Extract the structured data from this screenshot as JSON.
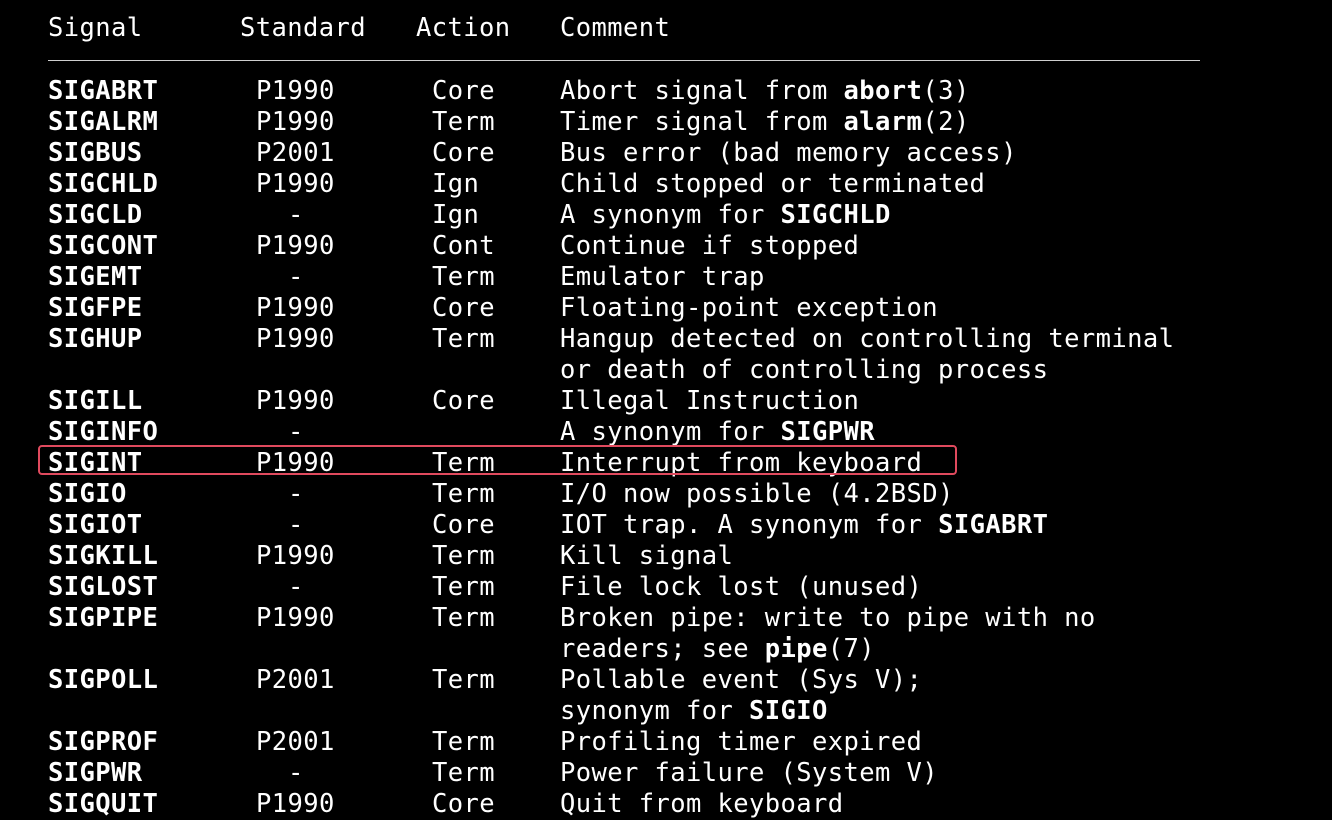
{
  "header": {
    "signal": "Signal",
    "standard": "Standard",
    "action": "Action",
    "comment": "Comment"
  },
  "highlight_color": "#e04a5e",
  "rows": [
    {
      "signal": "SIGABRT",
      "standard": "P1990",
      "action": "Core",
      "comment": [
        [
          {
            "t": "Abort signal from ",
            "b": false
          },
          {
            "t": "abort",
            "b": true
          },
          {
            "t": "(3)",
            "b": false
          }
        ]
      ]
    },
    {
      "signal": "SIGALRM",
      "standard": "P1990",
      "action": "Term",
      "comment": [
        [
          {
            "t": "Timer signal from ",
            "b": false
          },
          {
            "t": "alarm",
            "b": true
          },
          {
            "t": "(2)",
            "b": false
          }
        ]
      ]
    },
    {
      "signal": "SIGBUS",
      "standard": "P2001",
      "action": "Core",
      "comment": [
        [
          {
            "t": "Bus error (bad memory access)",
            "b": false
          }
        ]
      ]
    },
    {
      "signal": "SIGCHLD",
      "standard": "P1990",
      "action": "Ign",
      "comment": [
        [
          {
            "t": "Child stopped or terminated",
            "b": false
          }
        ]
      ]
    },
    {
      "signal": "SIGCLD",
      "standard": "-",
      "action": "Ign",
      "comment": [
        [
          {
            "t": "A synonym for ",
            "b": false
          },
          {
            "t": "SIGCHLD",
            "b": true
          }
        ]
      ]
    },
    {
      "signal": "SIGCONT",
      "standard": "P1990",
      "action": "Cont",
      "comment": [
        [
          {
            "t": "Continue if stopped",
            "b": false
          }
        ]
      ]
    },
    {
      "signal": "SIGEMT",
      "standard": "-",
      "action": "Term",
      "comment": [
        [
          {
            "t": "Emulator trap",
            "b": false
          }
        ]
      ]
    },
    {
      "signal": "SIGFPE",
      "standard": "P1990",
      "action": "Core",
      "comment": [
        [
          {
            "t": "Floating-point exception",
            "b": false
          }
        ]
      ]
    },
    {
      "signal": "SIGHUP",
      "standard": "P1990",
      "action": "Term",
      "comment": [
        [
          {
            "t": "Hangup detected on controlling terminal",
            "b": false
          }
        ],
        [
          {
            "t": "or death of controlling process",
            "b": false
          }
        ]
      ]
    },
    {
      "signal": "SIGILL",
      "standard": "P1990",
      "action": "Core",
      "comment": [
        [
          {
            "t": "Illegal Instruction",
            "b": false
          }
        ]
      ]
    },
    {
      "signal": "SIGINFO",
      "standard": "-",
      "action": "",
      "comment": [
        [
          {
            "t": "A synonym for ",
            "b": false
          },
          {
            "t": "SIGPWR",
            "b": true
          }
        ]
      ]
    },
    {
      "signal": "SIGINT",
      "standard": "P1990",
      "action": "Term",
      "comment": [
        [
          {
            "t": "Interrupt from keyboard",
            "b": false
          }
        ]
      ],
      "highlighted": true
    },
    {
      "signal": "SIGIO",
      "standard": "-",
      "action": "Term",
      "comment": [
        [
          {
            "t": "I/O now possible (4.2BSD)",
            "b": false
          }
        ]
      ]
    },
    {
      "signal": "SIGIOT",
      "standard": "-",
      "action": "Core",
      "comment": [
        [
          {
            "t": "IOT trap. A synonym for ",
            "b": false
          },
          {
            "t": "SIGABRT",
            "b": true
          }
        ]
      ]
    },
    {
      "signal": "SIGKILL",
      "standard": "P1990",
      "action": "Term",
      "comment": [
        [
          {
            "t": "Kill signal",
            "b": false
          }
        ]
      ]
    },
    {
      "signal": "SIGLOST",
      "standard": "-",
      "action": "Term",
      "comment": [
        [
          {
            "t": "File lock lost (unused)",
            "b": false
          }
        ]
      ]
    },
    {
      "signal": "SIGPIPE",
      "standard": "P1990",
      "action": "Term",
      "comment": [
        [
          {
            "t": "Broken pipe: write to pipe with no",
            "b": false
          }
        ],
        [
          {
            "t": "readers; see ",
            "b": false
          },
          {
            "t": "pipe",
            "b": true
          },
          {
            "t": "(7)",
            "b": false
          }
        ]
      ]
    },
    {
      "signal": "SIGPOLL",
      "standard": "P2001",
      "action": "Term",
      "comment": [
        [
          {
            "t": "Pollable event (Sys V);",
            "b": false
          }
        ],
        [
          {
            "t": "synonym for ",
            "b": false
          },
          {
            "t": "SIGIO",
            "b": true
          }
        ]
      ]
    },
    {
      "signal": "SIGPROF",
      "standard": "P2001",
      "action": "Term",
      "comment": [
        [
          {
            "t": "Profiling timer expired",
            "b": false
          }
        ]
      ]
    },
    {
      "signal": "SIGPWR",
      "standard": "-",
      "action": "Term",
      "comment": [
        [
          {
            "t": "Power failure (System V)",
            "b": false
          }
        ]
      ]
    },
    {
      "signal": "SIGQUIT",
      "standard": "P1990",
      "action": "Core",
      "comment": [
        [
          {
            "t": "Quit from keyboard",
            "b": false
          }
        ]
      ]
    }
  ]
}
